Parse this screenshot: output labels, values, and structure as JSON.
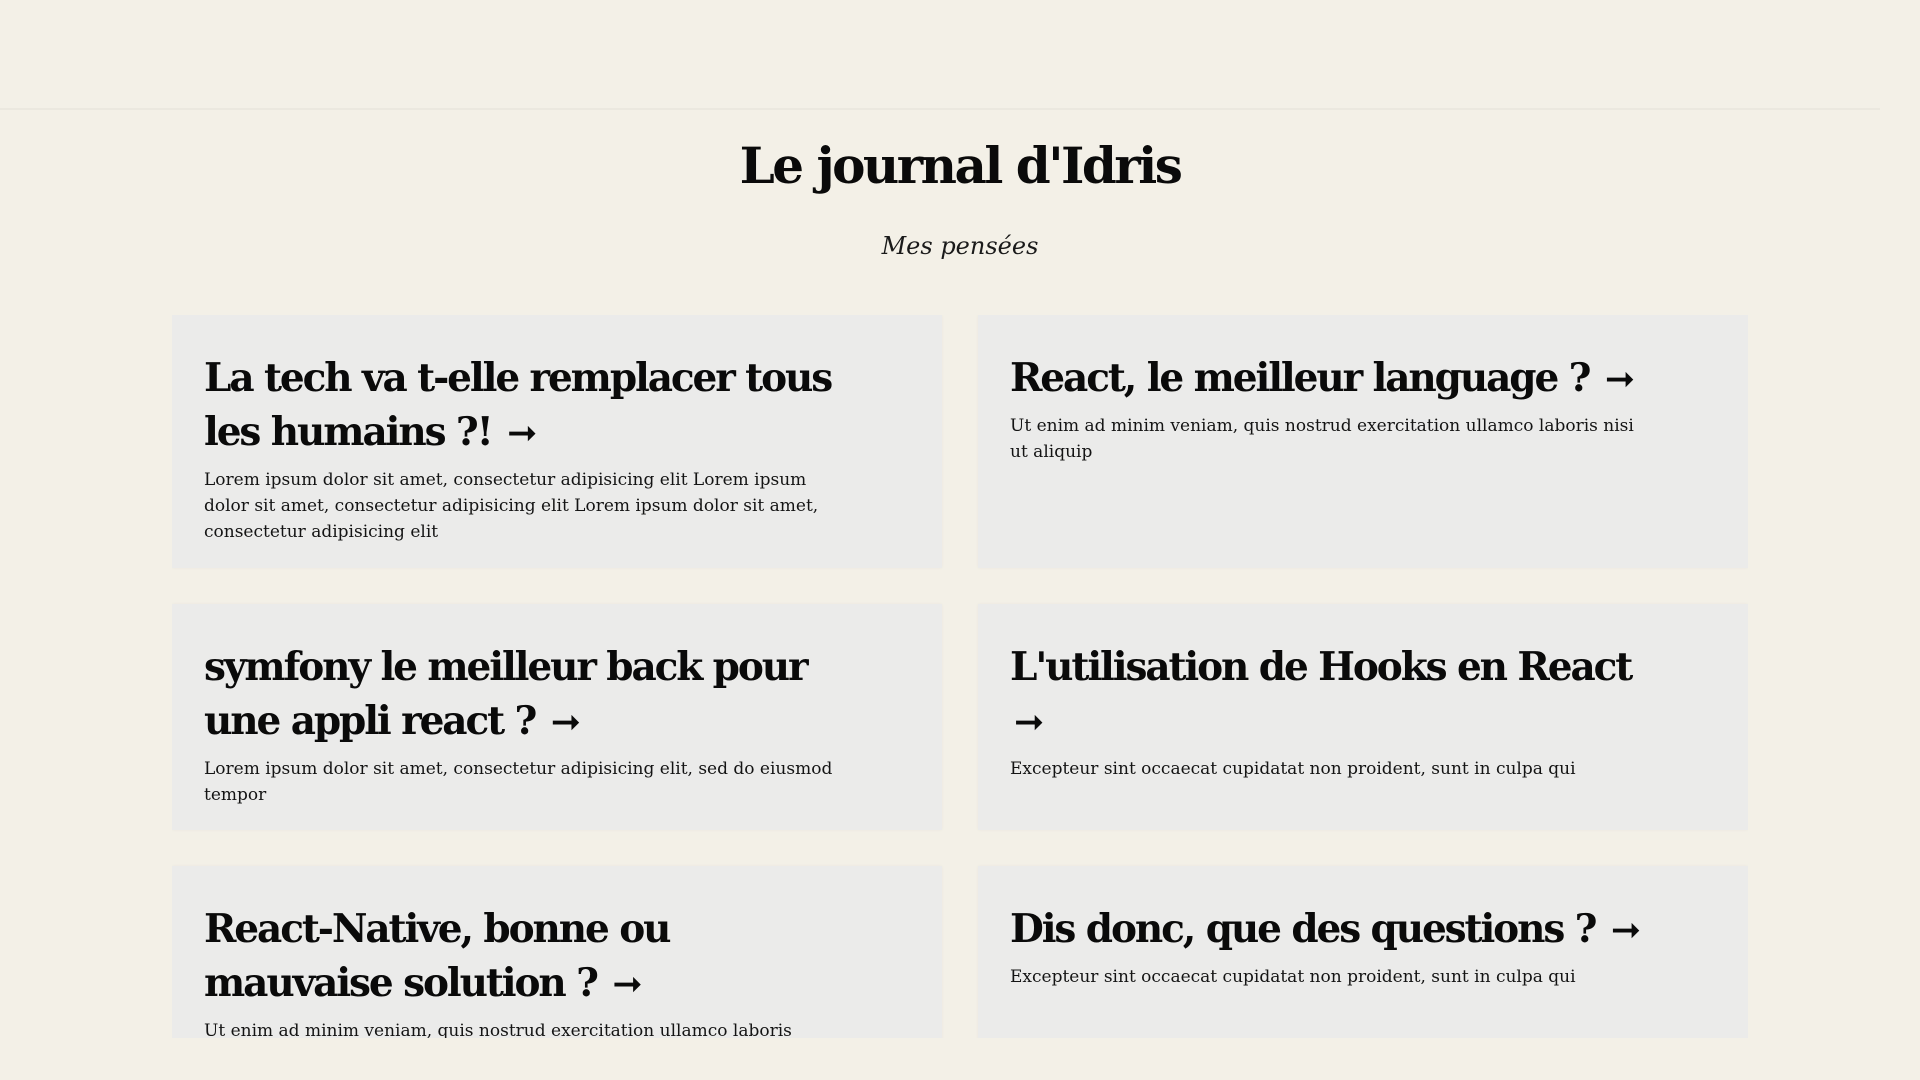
{
  "header": {
    "title": "Le journal d'Idris",
    "subtitle": "Mes pensées"
  },
  "icons": {
    "arrow": "arrow-right-icon"
  },
  "colors": {
    "background": "#f3f0e7",
    "card": "#ebebea",
    "text": "#0a0a0a"
  },
  "posts": [
    {
      "title": "La tech va t-elle remplacer tous les humains ?!",
      "arrow": "➞",
      "excerpt": "Lorem ipsum dolor sit amet, consectetur adipisicing elit Lorem ipsum dolor sit amet, consectetur adipisicing elit Lorem ipsum dolor sit amet, consectetur adipisicing elit"
    },
    {
      "title": "React, le meilleur language ?",
      "arrow": "➞",
      "excerpt": "Ut enim ad minim veniam, quis nostrud exercitation ullamco laboris nisi ut aliquip"
    },
    {
      "title": "symfony le meilleur back pour une appli react ?",
      "arrow": "➞",
      "excerpt": "Lorem ipsum dolor sit amet, consectetur adipisicing elit, sed do eiusmod tempor"
    },
    {
      "title": "L'utilisation de Hooks en React",
      "arrow": "➞",
      "excerpt": "Excepteur sint occaecat cupidatat non proident, sunt in culpa qui"
    },
    {
      "title": "React-Native, bonne ou mauvaise solution ?",
      "arrow": "➞",
      "excerpt": "Ut enim ad minim veniam, quis nostrud exercitation ullamco laboris"
    },
    {
      "title": "Dis donc, que des questions ?",
      "arrow": "➞",
      "excerpt": "Excepteur sint occaecat cupidatat non proident, sunt in culpa qui"
    }
  ]
}
